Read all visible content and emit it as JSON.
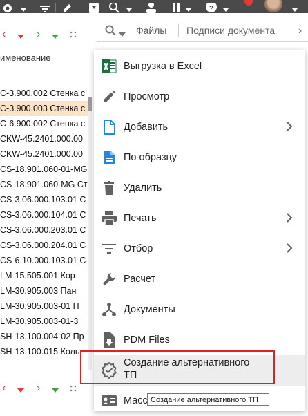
{
  "colors": {
    "toolbar": "#4a4a4a",
    "accent_green": "#43a047",
    "accent_red": "#e53935",
    "selected_row": "#fde3c6",
    "excel_green": "#1d6f42",
    "doc_blue": "#1e88e5"
  },
  "left": {
    "column_header": "именование",
    "rows": [
      "С-3.900.002 Стенка с",
      "С-3.900.003 Стенка с",
      "С-6.900.002 Стенка с",
      "CKW-45.2401.000.00",
      "CKW-45.2401.000.00",
      "CS-18.901.060-01-MG",
      "CS-18.901.060-MG Ст",
      "CS-3.06.000.103.01 С",
      "CS-3.06.000.104.01 С",
      "CS-3.06.000.203.01 С",
      "CS-3.06.000.204.01 С",
      "CS-6.10.000.103.01 С",
      "LM-15.505.001 Кор",
      "LM-30.905.003 Пан",
      "LM-30.905.003-01 П",
      "LM-30.905.003-01-3",
      "SH-13.100.004-02 Пр",
      "SH-13.100.015 Коль"
    ],
    "selected_index": 1
  },
  "tabs": {
    "files": "Файлы",
    "signatures": "Подписи документа"
  },
  "menu": {
    "items": [
      {
        "label": "Выгрузка в Excel",
        "icon": "excel-icon",
        "submenu": false
      },
      {
        "label": "Просмотр",
        "icon": "pencil-icon",
        "submenu": false
      },
      {
        "label": "Добавить",
        "icon": "new-document-icon",
        "submenu": true
      },
      {
        "label": "По образцу",
        "icon": "document-template-icon",
        "submenu": false
      },
      {
        "label": "Удалить",
        "icon": "trash-icon",
        "submenu": false
      },
      {
        "label": "Печать",
        "icon": "printer-icon",
        "submenu": true
      },
      {
        "label": "Отбор",
        "icon": "filter-icon",
        "submenu": true
      },
      {
        "label": "Расчет",
        "icon": "wrench-icon",
        "submenu": false
      },
      {
        "label": "Документы",
        "icon": "share-icon",
        "submenu": false
      },
      {
        "label": "PDM Files",
        "icon": "file-download-icon",
        "submenu": false
      },
      {
        "label_line1": "Создание альтернативного",
        "label_line2": "ТП",
        "icon": "verified-badge-icon",
        "submenu": false
      },
      {
        "label": "Масс",
        "icon": "id-card-icon",
        "submenu": false
      }
    ]
  },
  "tooltip": "Создание альтернативного ТП"
}
